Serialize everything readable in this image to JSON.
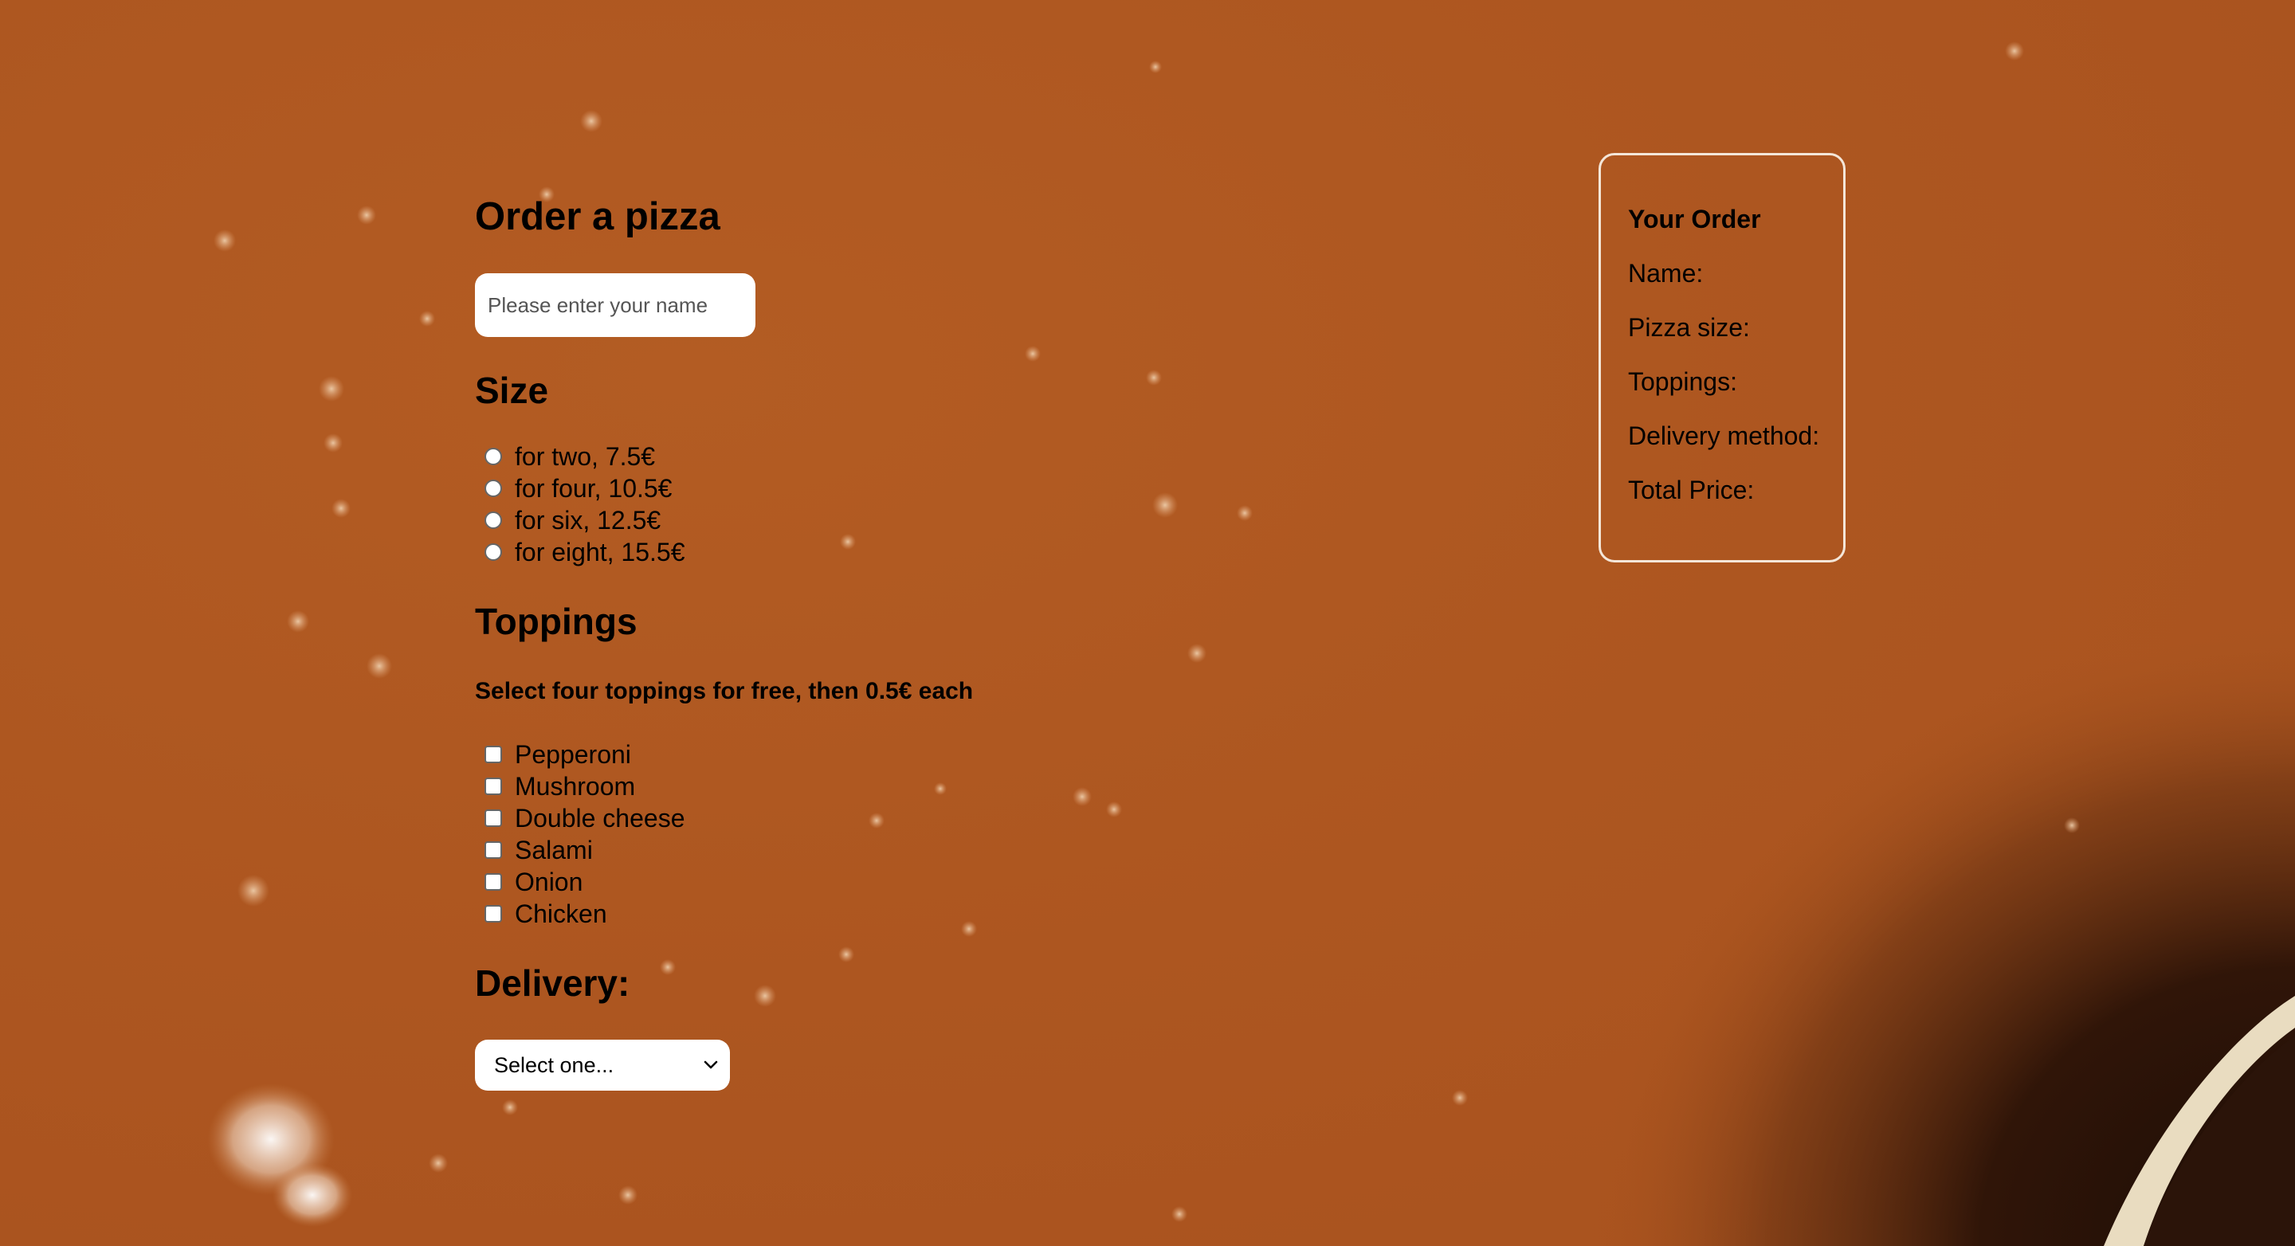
{
  "form": {
    "title": "Order a pizza",
    "name_placeholder": "Please enter your name",
    "size": {
      "heading": "Size",
      "options": [
        "for two, 7.5€",
        "for four, 10.5€",
        "for six, 12.5€",
        "for eight, 15.5€"
      ]
    },
    "toppings": {
      "heading": "Toppings",
      "note": "Select four toppings for free, then 0.5€ each",
      "options": [
        "Pepperoni",
        "Mushroom",
        "Double cheese",
        "Salami",
        "Onion",
        "Chicken"
      ]
    },
    "delivery": {
      "heading": "Delivery:",
      "selected": "Select one..."
    }
  },
  "order_summary": {
    "title": "Your Order",
    "name_label": "Name:",
    "size_label": "Pizza size:",
    "toppings_label": "Toppings:",
    "delivery_label": "Delivery method:",
    "total_label": "Total Price:"
  },
  "colors": {
    "background": "#ad5620",
    "panel_border": "#f4e6d8",
    "field_background": "#ffffff"
  }
}
